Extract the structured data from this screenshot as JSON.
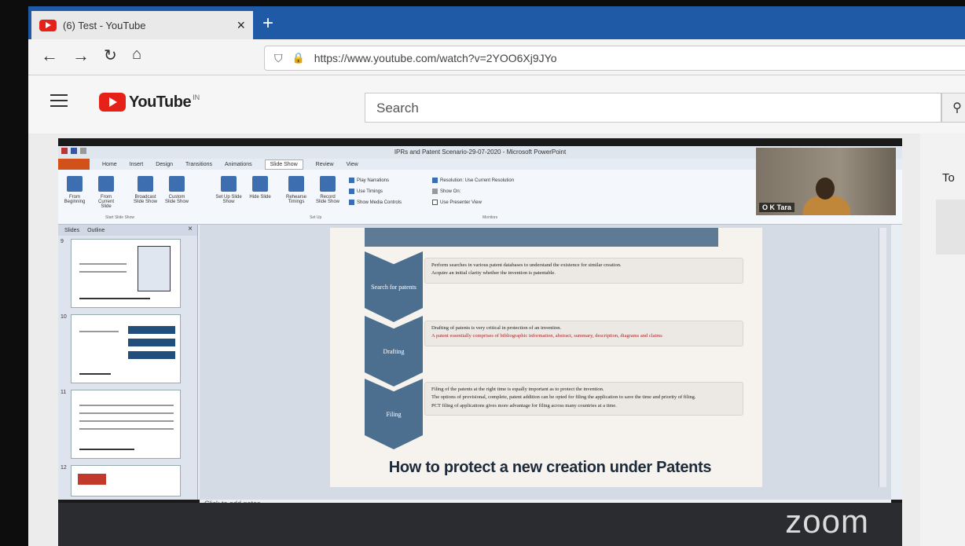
{
  "browser": {
    "tab_title": "(6) Test - YouTube",
    "tab_close": "×",
    "new_tab": "+",
    "url": "https://www.youtube.com/watch?v=2YOO6Xj9JYo"
  },
  "youtube": {
    "logo_text": "YouTube",
    "region": "IN",
    "search_placeholder": "Search",
    "sidebar_partial_title": "To"
  },
  "powerpoint": {
    "window_title": "IPRs and Patent Scenario-29-07-2020 - Microsoft PowerPoint",
    "tabs": [
      "Home",
      "Insert",
      "Design",
      "Transitions",
      "Animations",
      "Slide Show",
      "Review",
      "View"
    ],
    "active_tab": "Slide Show",
    "ribbon_buttons": [
      "From Beginning",
      "From Current Slide",
      "Broadcast Slide Show",
      "Custom Slide Show",
      "Set Up Slide Show",
      "Hide Slide",
      "Rehearse Timings",
      "Record Slide Show"
    ],
    "ribbon_checks": [
      "Play Narrations",
      "Use Timings",
      "Show Media Controls"
    ],
    "monitor_options": [
      "Resolution: Use Current Resolution",
      "Show On:",
      "Use Presenter View"
    ],
    "ribbon_groups": [
      "Start Slide Show",
      "Set Up",
      "Monitors"
    ],
    "left_tabs": [
      "Slides",
      "Outline"
    ],
    "slide_numbers": [
      "9",
      "10",
      "11",
      "12"
    ],
    "notes_placeholder": "Click to add notes"
  },
  "slide": {
    "steps": [
      {
        "label": "Search for patents",
        "bullets": [
          "Perform searches in various patent databases to understand the existence for similar creation.",
          "Acquire an initial clarity whether the invention is patentable."
        ]
      },
      {
        "label": "Drafting",
        "bullets": [
          "Drafting of patents is very critical in protection of an invention.",
          "A patent essentially comprises of bibliographic information, abstract, summary, description, diagrams and claims"
        ]
      },
      {
        "label": "Filing",
        "bullets": [
          "Filing of the patents at the right time is equally important as to protect the invention.",
          "The options of provisional, complete, patent addition can be opted for filing the application to save the time and priority of filing.",
          "PCT filing of applications gives more advantage for filing across many countries at a time."
        ]
      }
    ],
    "caption": "How to protect a new creation under Patents"
  },
  "zoom": {
    "logo": "zoom",
    "participant_name": "O K Tara"
  },
  "colors": {
    "browser_accent": "#1f5aa6",
    "youtube_red": "#e62117",
    "ppt_orange": "#d2501a",
    "chevron_blue": "#4d6f8f"
  }
}
